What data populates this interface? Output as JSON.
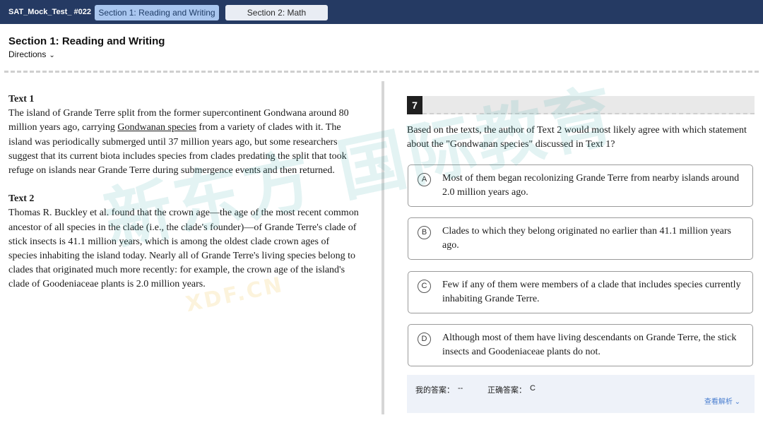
{
  "header": {
    "test_name": "SAT_Mock_Test_ #022",
    "tabs": [
      {
        "label": "Section 1: Reading and Writing",
        "active": true
      },
      {
        "label": "Section 2: Math",
        "active": false
      }
    ]
  },
  "section": {
    "title": "Section 1: Reading and Writing",
    "directions_label": "Directions"
  },
  "passages": {
    "text1_title": "Text 1",
    "text1_before": "The island of Grande Terre split from the former supercontinent Gondwana around 80 million years ago, carrying ",
    "text1_underlined": "Gondwanan species",
    "text1_after": " from a variety of clades with it. The island was periodically submerged until 37 million years ago, but some researchers suggest that its current biota includes species from clades predating the split that took refuge on islands near Grande Terre during submergence events and then returned.",
    "text2_title": "Text 2",
    "text2_body": "Thomas R. Buckley et al. found that the crown age—the age of the most recent common ancestor of all species in the clade (i.e., the clade's founder)—of Grande Terre's clade of stick insects is 41.1 million years, which is among the oldest clade crown ages of species inhabiting the island today. Nearly all of Grande Terre's living species belong to clades that originated much more recently: for example, the crown age of the island's clade of Goodeniaceae plants is 2.0 million years."
  },
  "question": {
    "number": "7",
    "stem": "Based on the texts, the author of Text 2 would most likely agree with which statement about the \"Gondwanan species\" discussed in Text 1?",
    "choices": [
      {
        "letter": "A",
        "text": "Most of them began recolonizing Grande Terre from nearby islands around 2.0 million years ago."
      },
      {
        "letter": "B",
        "text": "Clades to which they belong originated no earlier than 41.1 million years ago."
      },
      {
        "letter": "C",
        "text": "Few if any of them were members of a clade that includes species currently inhabiting Grande Terre."
      },
      {
        "letter": "D",
        "text": "Although most of them have living descendants on Grande Terre, the stick insects and Goodeniaceae plants do not."
      }
    ]
  },
  "answer_panel": {
    "my_answer_label": "我的答案：",
    "my_answer_value": "--",
    "correct_answer_label": "正确答案：",
    "correct_answer_value": "C",
    "view_explanation": "查看解析"
  },
  "watermark": {
    "main": "新东方 国际教育",
    "sub": "XDF.CN"
  },
  "colors": {
    "topbar": "#253a63",
    "active_tab": "#a9c6ef",
    "inactive_tab": "#e9edf4",
    "answer_panel": "#eef2f9",
    "link": "#4a7fd0"
  }
}
